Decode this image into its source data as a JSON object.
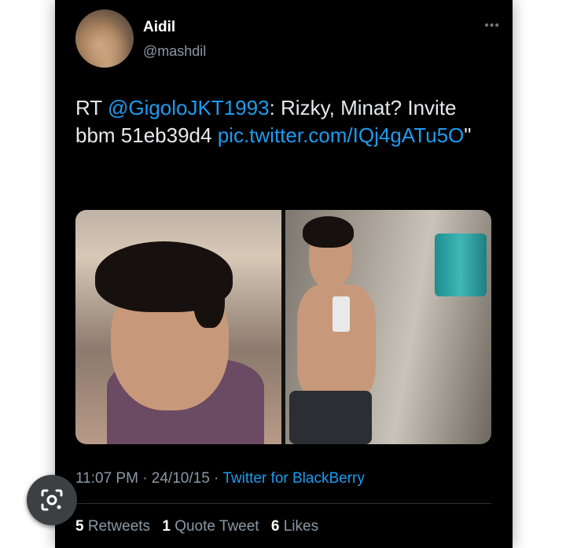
{
  "tweet": {
    "user": {
      "name": "Aidil",
      "handle": "@mashdil"
    },
    "text": {
      "prefix": "RT ",
      "mention": "@GigoloJKT1993",
      "middle": ": Rizky, Minat? Invite bbm 51eb39d4 ",
      "link": "pic.twitter.com/IQj4gATu5O",
      "suffix": "\""
    },
    "time": "11:07 PM · 24/10/15 ·",
    "source": "Twitter for BlackBerry",
    "stats": {
      "retweets_count": "5",
      "retweets_label": "Retweets",
      "quotes_count": "1",
      "quotes_label": "Quote Tweet",
      "likes_count": "6",
      "likes_label": "Likes"
    }
  },
  "icons": {
    "more": "more-icon",
    "lens": "google-lens-icon"
  },
  "colors": {
    "background": "#000000",
    "text": "#e7e9ea",
    "link": "#1d9bf0",
    "muted": "#8b98a5"
  }
}
